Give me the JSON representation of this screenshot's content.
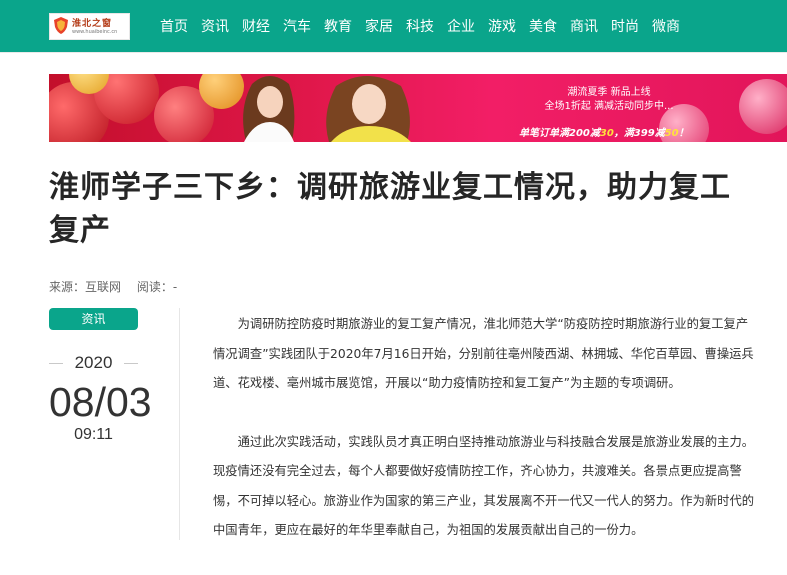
{
  "logo": {
    "text": "淮北之窗",
    "url": "www.huaibeinc.cn"
  },
  "nav": [
    "首页",
    "资讯",
    "财经",
    "汽车",
    "教育",
    "家居",
    "科技",
    "企业",
    "游戏",
    "美食",
    "商讯",
    "时尚",
    "微商"
  ],
  "banner": {
    "line1": "潮流夏季  新品上线",
    "line2": "全场1折起  满减活动同步中...",
    "promo_prefix": "单笔订单满200减",
    "promo_a": "30",
    "promo_mid": "，满399减",
    "promo_b": "50",
    "promo_suffix": "！"
  },
  "article": {
    "title": "淮师学子三下乡：调研旅游业复工情况，助力复工复产",
    "source_label": "来源：互联网",
    "reads_label": "阅读：-",
    "tag": "资讯",
    "date_year": "2020",
    "date_md": "08/03",
    "date_time": "09:11",
    "paragraphs": [
      "为调研防控防疫时期旅游业的复工复产情况，淮北师范大学“防疫防控时期旅游行业的复工复产情况调查”实践团队于2020年7月16日开始，分别前往亳州陵西湖、林拥城、华佗百草园、曹操运兵道、花戏楼、亳州城市展览馆，开展以“助力疫情防控和复工复产”为主题的专项调研。",
      "通过此次实践活动，实践队员才真正明白坚持推动旅游业与科技融合发展是旅游业发展的主力。现疫情还没有完全过去，每个人都要做好疫情防控工作，齐心协力，共渡难关。各景点更应提高警惕，不可掉以轻心。旅游业作为国家的第三产业，其发展离不开一代又一代人的努力。作为新时代的中国青年，更应在最好的年华里奉献自己，为祖国的发展贡献出自己的一份力。"
    ]
  },
  "colors": {
    "brand": "#0aa58b",
    "banner": "#e0174a",
    "promo": "#ffe13c"
  }
}
